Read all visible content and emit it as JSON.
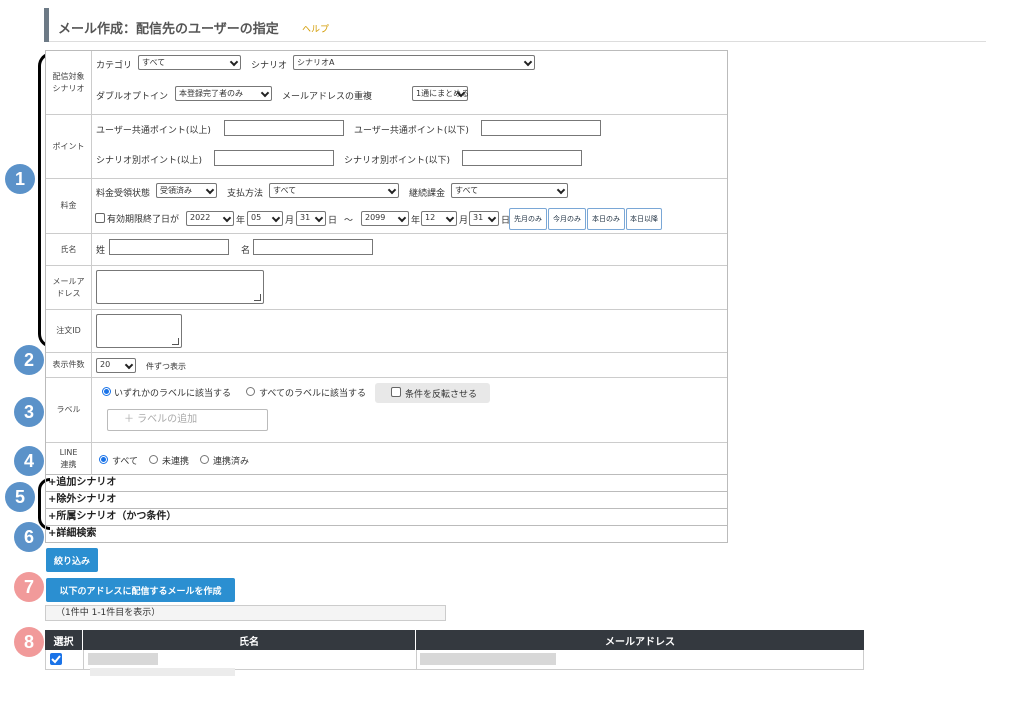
{
  "header": {
    "title": "メール作成：配信先のユーザーの指定",
    "help": "ヘルプ"
  },
  "markers": [
    "1",
    "2",
    "3",
    "4",
    "5",
    "6",
    "7",
    "8"
  ],
  "scenario": {
    "label_l1": "配信対象",
    "label_l2": "シナリオ",
    "category_label": "カテゴリ",
    "category_value": "すべて",
    "scenario_label": "シナリオ",
    "scenario_value": "シナリオA",
    "optin_label": "ダブルオプトイン",
    "optin_value": "本登録完了者のみ",
    "dup_label": "メールアドレスの重複",
    "dup_value": "1通にまとめる"
  },
  "points": {
    "label": "ポイント",
    "common_min": "ユーザー共通ポイント(以上)",
    "common_max": "ユーザー共通ポイント(以下)",
    "scen_min": "シナリオ別ポイント(以上)",
    "scen_max": "シナリオ別ポイント(以下)"
  },
  "fee": {
    "label": "料金",
    "status_label": "料金受領状態",
    "status_value": "受領済み",
    "method_label": "支払方法",
    "method_value": "すべて",
    "cont_label": "継続課金",
    "cont_value": "すべて",
    "expiry_label": "有効期限終了日が",
    "from_year": "2022",
    "year_unit": "年",
    "from_month": "05",
    "month_unit": "月",
    "from_day": "31",
    "day_unit": "日",
    "tilde": "～",
    "to_year": "2099",
    "to_month": "12",
    "to_day": "31",
    "btn_last_month": "先月のみ",
    "btn_this_month": "今月のみ",
    "btn_today": "本日のみ",
    "btn_after_today": "本日以降"
  },
  "name": {
    "label": "氏名",
    "sei": "姓",
    "mei": "名"
  },
  "email": {
    "label_l1": "メールア",
    "label_l2": "ドレス"
  },
  "order": {
    "label": "注文ID"
  },
  "count": {
    "label": "表示件数",
    "value": "20",
    "suffix": "件ずつ表示"
  },
  "labels": {
    "label": "ラベル",
    "any": "いずれかのラベルに該当する",
    "all": "すべてのラベルに該当する",
    "invert": "条件を反転させる",
    "add": "＋ ラベルの追加"
  },
  "line": {
    "label_l1": "LINE",
    "label_l2": "連携",
    "all": "すべて",
    "not": "未連携",
    "done": "連携済み"
  },
  "sections": {
    "add": "+追加シナリオ",
    "exclude": "+除外シナリオ",
    "belong": "+所属シナリオ（かつ条件）",
    "detail": "+詳細検索"
  },
  "buttons": {
    "filter": "絞り込み",
    "create": "以下のアドレスに配信するメールを作成"
  },
  "summary": "（1件中 1-1件目を表示）",
  "table": {
    "col_select": "選択",
    "col_name": "氏名",
    "col_email": "メールアドレス"
  }
}
